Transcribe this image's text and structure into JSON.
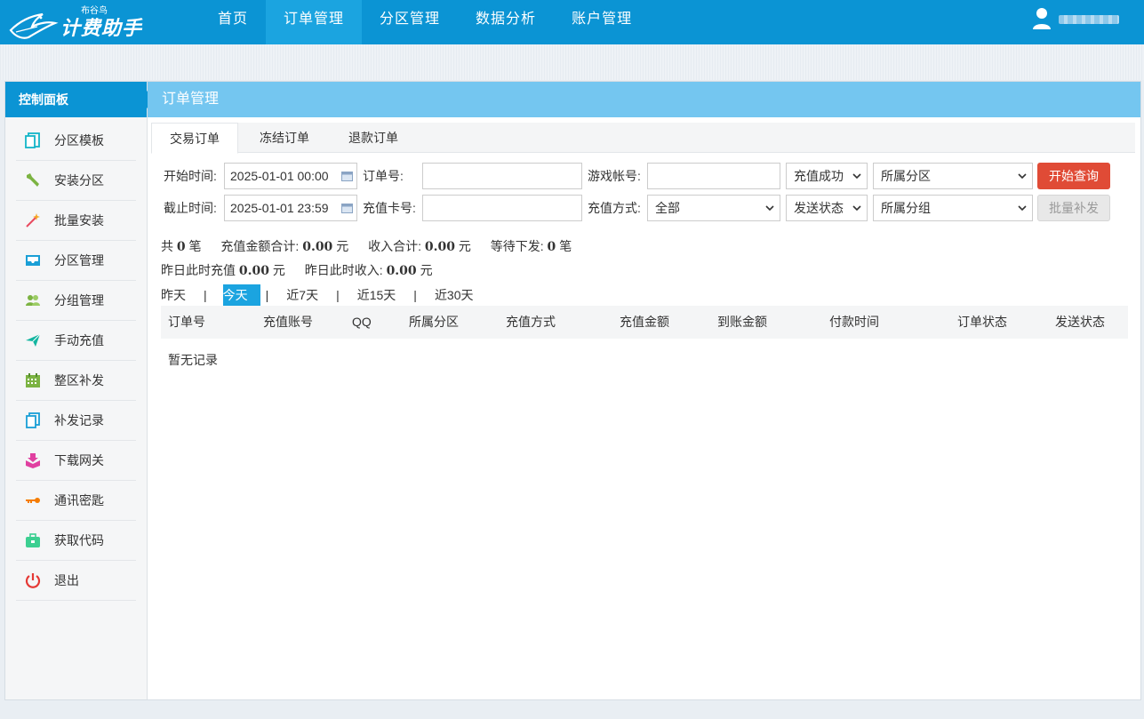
{
  "app": {
    "logo_small": "布谷鸟",
    "logo_main": "计费助手"
  },
  "nav": [
    {
      "label": "首页"
    },
    {
      "label": "订单管理"
    },
    {
      "label": "分区管理"
    },
    {
      "label": "数据分析"
    },
    {
      "label": "账户管理"
    }
  ],
  "sidebar": {
    "title": "控制面板",
    "items": [
      {
        "label": "分区模板",
        "icon": "template-icon"
      },
      {
        "label": "安装分区",
        "icon": "wrench-icon"
      },
      {
        "label": "批量安装",
        "icon": "magic-wand-icon"
      },
      {
        "label": "分区管理",
        "icon": "inbox-icon"
      },
      {
        "label": "分组管理",
        "icon": "users-icon"
      },
      {
        "label": "手动充值",
        "icon": "paper-plane-icon"
      },
      {
        "label": "整区补发",
        "icon": "calendar-icon"
      },
      {
        "label": "补发记录",
        "icon": "copy-icon"
      },
      {
        "label": "下载网关",
        "icon": "download-box-icon"
      },
      {
        "label": "通讯密匙",
        "icon": "key-icon"
      },
      {
        "label": "获取代码",
        "icon": "briefcase-icon"
      },
      {
        "label": "退出",
        "icon": "power-icon"
      }
    ]
  },
  "content": {
    "title": "订单管理",
    "tabs": [
      {
        "label": "交易订单"
      },
      {
        "label": "冻结订单"
      },
      {
        "label": "退款订单"
      }
    ]
  },
  "filters": {
    "start_label": "开始时间:",
    "start_value": "2025-01-01 00:00",
    "order_no_label": "订单号:",
    "order_no_value": "",
    "game_account_label": "游戏帐号:",
    "game_account_value": "",
    "status_select": "充值成功",
    "zone_select": "所属分区",
    "end_label": "截止时间:",
    "end_value": "2025-01-01 23:59",
    "card_no_label": "充值卡号:",
    "card_no_value": "",
    "pay_method_label": "充值方式:",
    "pay_method_select": "全部",
    "send_status_select": "发送状态",
    "group_select": "所属分组",
    "query_button": "开始查询",
    "batch_button": "批量补发"
  },
  "stats": {
    "total_prefix": "共",
    "total_count": "0",
    "total_unit": "笔",
    "recharge_sum_label": "充值金额合计:",
    "recharge_sum": "0.00",
    "income_sum_label": "收入合计:",
    "income_sum": "0.00",
    "pending_label": "等待下发:",
    "pending_count": "0",
    "pending_unit": "笔",
    "yuan": "元",
    "yesterday_recharge_label": "昨日此时充值",
    "yesterday_recharge": "0.00",
    "yesterday_income_label": "昨日此时收入:",
    "yesterday_income": "0.00"
  },
  "ranges": [
    {
      "label": "昨天"
    },
    {
      "label": "今天"
    },
    {
      "label": "近7天"
    },
    {
      "label": "近15天"
    },
    {
      "label": "近30天"
    }
  ],
  "range_sep": "|",
  "table": {
    "columns": [
      "订单号",
      "充值账号",
      "QQ",
      "所属分区",
      "充值方式",
      "充值金额",
      "到账金额",
      "付款时间",
      "订单状态",
      "发送状态"
    ],
    "empty_text": "暂无记录"
  },
  "colors": {
    "primary": "#0b94d4",
    "header_light": "#74c6f0",
    "danger": "#e04b36"
  }
}
